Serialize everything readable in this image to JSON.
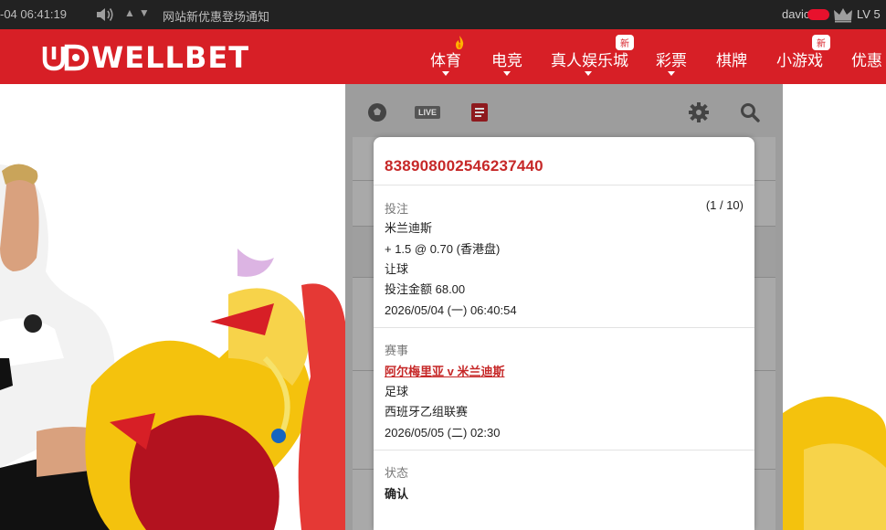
{
  "topbar": {
    "time": "-04 06:41:19",
    "notice": "网站新优惠登场通知",
    "username": "davic",
    "level": "LV 5",
    "icons": [
      "speaker-icon",
      "arrow-up-icon",
      "arrow-down-icon",
      "crown-icon"
    ]
  },
  "header": {
    "logo_text": "WELLBET",
    "nav": [
      {
        "label": "体育",
        "active": true
      },
      {
        "label": "电竞"
      },
      {
        "label": "真人娱乐城",
        "badge": "新"
      },
      {
        "label": "彩票"
      },
      {
        "label": "棋牌"
      },
      {
        "label": "小游戏",
        "badge": "新"
      },
      {
        "label": "优惠"
      }
    ]
  },
  "panel": {
    "tools": [
      "soccer-ball-icon",
      "live-icon",
      "bet-slip-icon",
      "gear-icon",
      "search-icon"
    ],
    "live_label": "LIVE"
  },
  "receipt": {
    "order_id": "838908002546237440",
    "bet": {
      "label": "投注",
      "count": "(1 / 10)",
      "team": "米兰迪斯",
      "odds": "+ 1.5 @ 0.70 (香港盘)",
      "market": "让球",
      "stake": "投注金额 68.00",
      "placed_at": "2026/05/04 (一) 06:40:54"
    },
    "event": {
      "label": "赛事",
      "match": "阿尔梅里亚 v 米兰迪斯",
      "sport": "足球",
      "league": "西班牙乙组联赛",
      "kickoff": "2026/05/05 (二) 02:30"
    },
    "status": {
      "label": "状态",
      "value": "确认"
    }
  },
  "colors": {
    "brand_red": "#d71f26",
    "topbar": "#222222",
    "accent_text": "#c62828"
  }
}
